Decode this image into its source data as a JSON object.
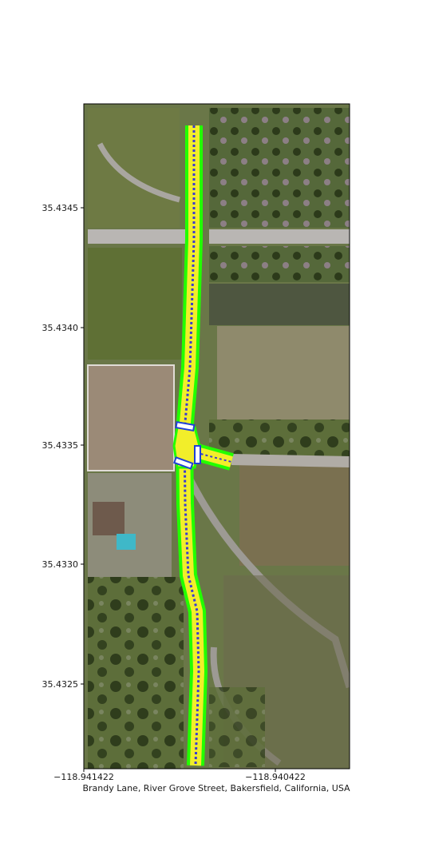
{
  "figure": {
    "xlabel": "Brandy Lane, River Grove Street, Bakersfield, California, USA",
    "x_ticks": [
      "−118.941422",
      "−118.940422"
    ],
    "y_ticks": [
      "35.4345",
      "35.4340",
      "35.4335",
      "35.4330",
      "35.4325"
    ]
  },
  "colors": {
    "road_outer": "#22ff00",
    "road_inner": "#f2ee2a",
    "lane_line": "#3a3ad0",
    "crosswalk": "#1f3fd8",
    "grass": "#6b7a48",
    "dark_grass": "#4a5a2e",
    "dirt": "#9a8a72",
    "paved": "#b8b4ae"
  }
}
